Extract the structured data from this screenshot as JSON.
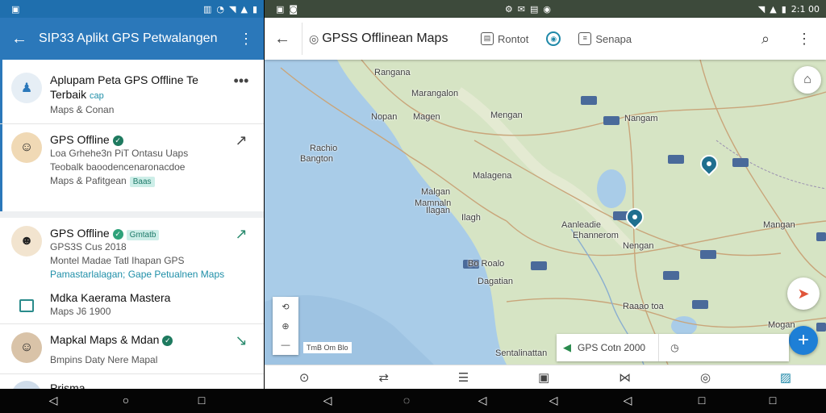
{
  "left": {
    "status_time": "",
    "appbar_title": "SIP33 Aplikt GPS Petwalangen",
    "items": [
      {
        "title": "Aplupam Peta GPS Offline Te",
        "line2": "Terbaik",
        "line2_link": "cap",
        "line3": "Maps & Conan"
      },
      {
        "title": "GPS Offline",
        "line2": "Loa Grhehe3n PiT Ontasu Uaps",
        "line3": "Teobalk baoodencenaronacdoe",
        "line4": "Maps & Pafitgean",
        "line4_badge": "Baas"
      },
      {
        "title": "GPS Offline",
        "title_badge": "Gmtatb",
        "line2": "GPS3S Cus 2018",
        "line3": "Montel Madae Tatl Ihapan GPS",
        "line4": "Pamastarlalagan; Gape Petualnen Maps"
      },
      {
        "title": "Mdka Kaerama Mastera",
        "line2": "Maps J6 1900"
      },
      {
        "title": "Mapkal Maps & Mdan",
        "line2": "Bmpins Daty Nere Mapal"
      },
      {
        "title": "Prisma"
      }
    ]
  },
  "right": {
    "status_time": "2:1 00",
    "search_label": "GPSS Offlinean Maps",
    "chip1": "Rontot",
    "chip2": "Senapa",
    "info_text": "GPS Cotn 2000",
    "scale_text": "TmB Om Blo",
    "map_labels": [
      {
        "text": "Rangana"
      },
      {
        "text": "Marangalon"
      },
      {
        "text": "Nopan"
      },
      {
        "text": "Magen"
      },
      {
        "text": "Mengan"
      },
      {
        "text": "Nangam"
      },
      {
        "text": "Rachio"
      },
      {
        "text": "Bangton"
      },
      {
        "text": "Malagena"
      },
      {
        "text": "Malgan"
      },
      {
        "text": "Mamnaln"
      },
      {
        "text": "Ilagan"
      },
      {
        "text": "Ilagh"
      },
      {
        "text": "Aanleadie"
      },
      {
        "text": "Ehannerom"
      },
      {
        "text": "Nengan"
      },
      {
        "text": "Mangan"
      },
      {
        "text": "Bo Roalo"
      },
      {
        "text": "Dagatian"
      },
      {
        "text": "Raaao toa"
      },
      {
        "text": "Mogan"
      },
      {
        "text": "Sentalinattan"
      }
    ]
  },
  "colors": {
    "appbar": "#2b78ba",
    "accent": "#1e88a8",
    "fab": "#1e7fd6",
    "water": "#a9cce8",
    "land": "#d6e4c4"
  }
}
